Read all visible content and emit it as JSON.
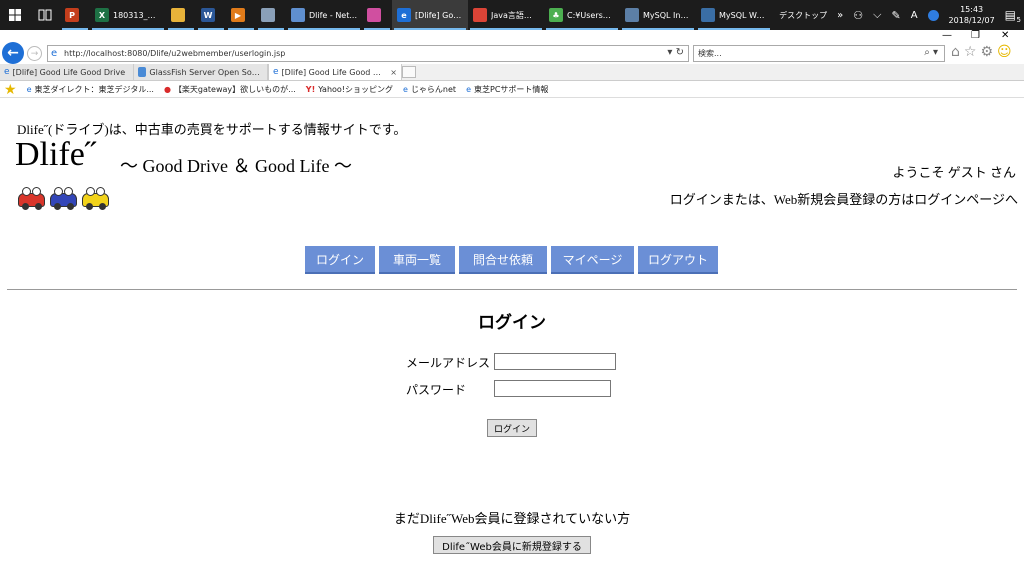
{
  "taskbar": {
    "apps": [
      {
        "label": "",
        "icon": "powerpoint-icon",
        "color": "#c43e1c",
        "glyph": "P"
      },
      {
        "label": "180313_カリ...",
        "icon": "excel-icon",
        "color": "#1e7145",
        "glyph": "X"
      },
      {
        "label": "",
        "icon": "folder-icon",
        "color": "#e8b33a",
        "glyph": ""
      },
      {
        "label": "",
        "icon": "word-icon",
        "color": "#2b5797",
        "glyph": "W"
      },
      {
        "label": "",
        "icon": "media-icon",
        "color": "#e07b1a",
        "glyph": "▶"
      },
      {
        "label": "",
        "icon": "network-icon",
        "color": "#8aa0b8",
        "glyph": ""
      },
      {
        "label": "Dlife - Net...",
        "icon": "netbeans-icon",
        "color": "#5f8fcf",
        "glyph": ""
      },
      {
        "label": "",
        "icon": "app-icon",
        "color": "#d04fa0",
        "glyph": ""
      },
      {
        "label": "[Dlife] Goo...",
        "icon": "ie-icon",
        "color": "#1e6fd6",
        "glyph": "e",
        "active": true
      },
      {
        "label": "Java言語入...",
        "icon": "chrome-icon",
        "color": "#db4437",
        "glyph": ""
      },
      {
        "label": "C:¥Users¥1...",
        "icon": "clover-icon",
        "color": "#4caf50",
        "glyph": "♣"
      },
      {
        "label": "MySQL Inst...",
        "icon": "mysql-installer-icon",
        "color": "#5c7fa6",
        "glyph": ""
      },
      {
        "label": "MySQL Wor...",
        "icon": "mysql-workbench-icon",
        "color": "#3a6ea5",
        "glyph": ""
      }
    ],
    "desktop_label": "デスクトップ",
    "ime": "A",
    "time": "15:43",
    "date": "2018/12/07",
    "notify_count": "5"
  },
  "browser": {
    "url": "http://localhost:8080/Dlife/u2webmember/userlogin.jsp",
    "search_placeholder": "検索...",
    "tabs": [
      {
        "label": "[Dlife] Good Life Good Drive",
        "active": false
      },
      {
        "label": "GlassFish Server Open Source E...",
        "active": false
      },
      {
        "label": "[Dlife] Good Life Good Drive",
        "active": true
      }
    ],
    "favorites": [
      {
        "label": "東芝ダイレクト：東芝デジタル...",
        "icon": "e"
      },
      {
        "label": "【楽天gateway】欲しいものが...",
        "icon": "R"
      },
      {
        "label": "Yahoo!ショッピング",
        "icon": "Y!"
      },
      {
        "label": "じゃらんnet",
        "icon": "e"
      },
      {
        "label": "東芝PCサポート情報",
        "icon": "e"
      }
    ]
  },
  "page": {
    "tagline": "Dlife˝(ドライブ)は、中古車の売買をサポートする情報サイトです。",
    "logo": "Dlife˝",
    "subtitle": "～ Good Drive ＆ Good Life ～",
    "welcome": "ようこそ ゲスト さん",
    "login_prompt": "ログインまたは、Web新規会員登録の方はログインページへ",
    "nav": [
      "ログイン",
      "車両一覧",
      "問合せ依頼",
      "マイページ",
      "ログアウト"
    ],
    "title": "ログイン",
    "email_label": "メールアドレス",
    "password_label": "パスワード",
    "email_value": "",
    "password_value": "",
    "login_button": "ログイン",
    "not_registered": "まだDlife˝Web会員に登録されていない方",
    "register_button": "Dlife˝Web会員に新規登録する"
  }
}
